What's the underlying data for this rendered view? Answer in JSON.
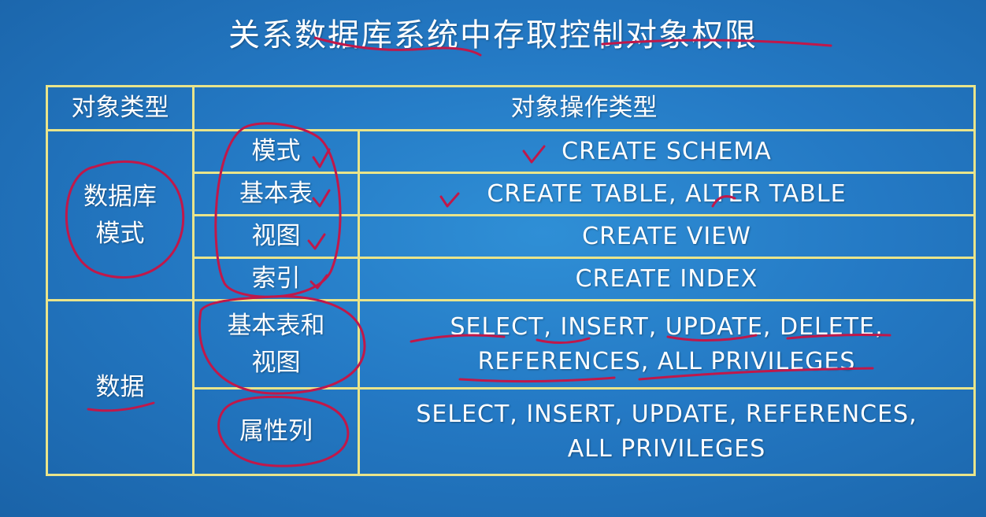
{
  "title": "关系数据库系统中存取控制对象权限",
  "headers": {
    "object_type": "对象类型",
    "operation_type": "对象操作类型"
  },
  "groups": {
    "schema": "数据库模式",
    "data": "数据"
  },
  "rows": [
    {
      "object": "模式",
      "ops": [
        "CREATE SCHEMA"
      ]
    },
    {
      "object": "基本表",
      "ops": [
        "CREATE TABLE, ALTER TABLE"
      ]
    },
    {
      "object": "视图",
      "ops": [
        "CREATE VIEW"
      ]
    },
    {
      "object": "索引",
      "ops": [
        "CREATE INDEX"
      ]
    },
    {
      "object": "基本表和视图",
      "ops": [
        "SELECT, INSERT, UPDATE, DELETE,",
        "REFERENCES, ALL PRIVILEGES"
      ]
    },
    {
      "object": "属性列",
      "ops": [
        "SELECT, INSERT, UPDATE, REFERENCES,",
        "ALL PRIVILEGES"
      ]
    }
  ],
  "colors": {
    "background": "#2479c4",
    "grid_lines": "#e9e48a",
    "text": "#ffffff",
    "annotation_ink": "#c0184a"
  }
}
